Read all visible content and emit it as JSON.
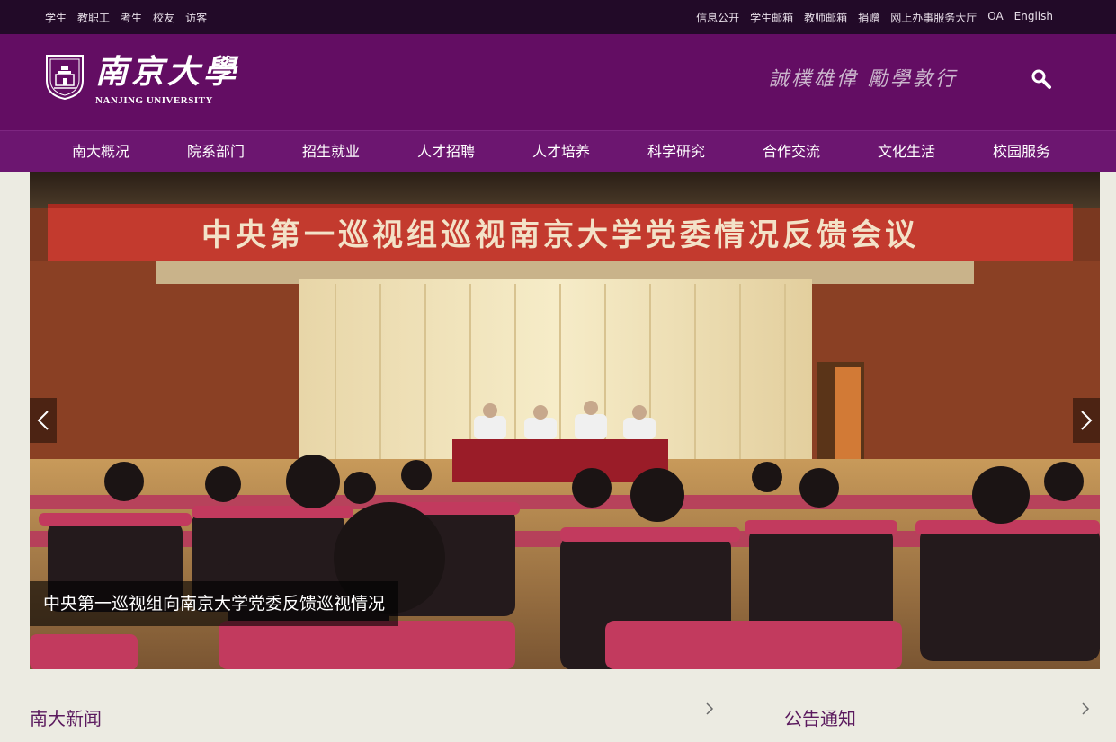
{
  "topbar": {
    "left_links": [
      "学生",
      "教职工",
      "考生",
      "校友",
      "访客"
    ],
    "right_links": [
      "信息公开",
      "学生邮箱",
      "教师邮箱",
      "捐赠",
      "网上办事服务大厅",
      "OA",
      "English"
    ]
  },
  "header": {
    "logo_cn": "南京大學",
    "logo_en": "NANJING UNIVERSITY",
    "motto": "誠樸雄偉 勵學敦行",
    "search_icon": "search-icon"
  },
  "nav": {
    "items": [
      "南大概况",
      "院系部门",
      "招生就业",
      "人才招聘",
      "人才培养",
      "科学研究",
      "合作交流",
      "文化生活",
      "校园服务"
    ]
  },
  "banner": {
    "slide_banner_text": "中央第一巡视组巡视南京大学党委情况反馈会议",
    "caption": "中央第一巡视组向南京大学党委反馈巡视情况"
  },
  "sections": {
    "news_title": "南大新闻",
    "notice_title": "公告通知"
  },
  "colors": {
    "brand_purple": "#630d63",
    "topbar": "#220a28",
    "nav": "#6c1670",
    "page_bg": "#ecebe2",
    "section_title": "#5b1a5e"
  }
}
